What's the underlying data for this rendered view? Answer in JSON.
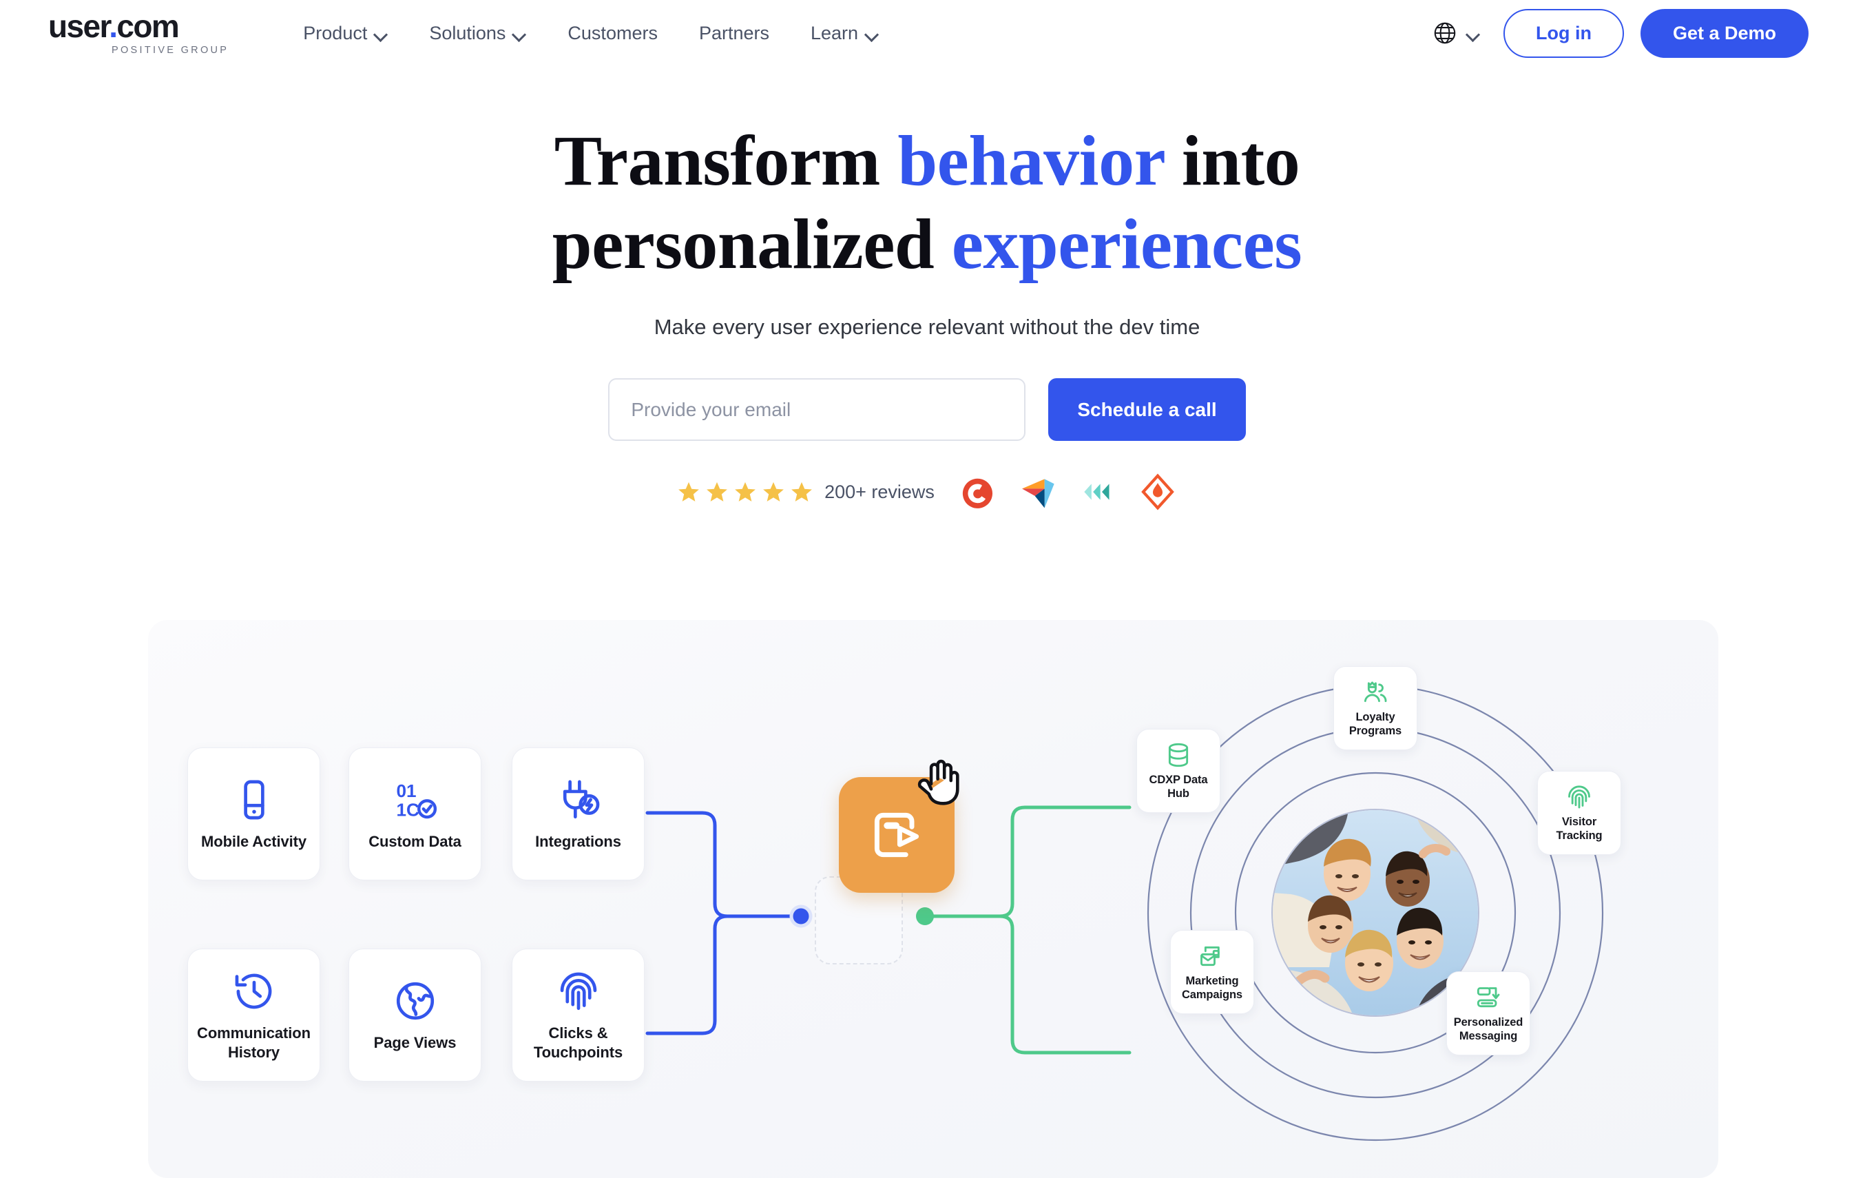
{
  "header": {
    "logo": {
      "text_main": "user",
      "text_dot": ".",
      "text_com": "com",
      "tagline": "POSITIVE GROUP"
    },
    "nav": [
      {
        "label": "Product",
        "has_dropdown": true
      },
      {
        "label": "Solutions",
        "has_dropdown": true
      },
      {
        "label": "Customers",
        "has_dropdown": false
      },
      {
        "label": "Partners",
        "has_dropdown": false
      },
      {
        "label": "Learn",
        "has_dropdown": true
      }
    ],
    "language_icon": "globe-icon",
    "login_label": "Log in",
    "demo_label": "Get a Demo"
  },
  "hero": {
    "headline_part1": "Transform ",
    "headline_highlight1": "behavior",
    "headline_part2": " into",
    "headline_part3": "personalized ",
    "headline_highlight2": "experiences",
    "subheadline": "Make every user experience relevant without the dev time",
    "email_placeholder": "Provide your email",
    "email_value": "",
    "cta_label": "Schedule a call",
    "reviews_count": "200+ reviews",
    "star_count": 5,
    "review_logos": [
      "g2-logo",
      "capterra-logo",
      "getapp-logo",
      "software-advice-logo"
    ]
  },
  "diagram": {
    "source_cards": [
      {
        "label": "Mobile Activity",
        "icon": "mobile-phone-icon"
      },
      {
        "label": "Custom Data",
        "icon": "binary-check-icon"
      },
      {
        "label": "Integrations",
        "icon": "plug-bolt-icon"
      },
      {
        "label": "Communication History",
        "icon": "clock-history-icon"
      },
      {
        "label": "Page Views",
        "icon": "globe-grid-icon"
      },
      {
        "label": "Clicks & Touchpoints",
        "icon": "fingerprint-icon"
      }
    ],
    "center_node": {
      "icon": "data-export-icon",
      "color": "#eda04a"
    },
    "cursor": "pointer-hand-cursor",
    "orbit_cards": [
      {
        "label": "Loyalty Programs",
        "icon": "loyalty-users-crown-icon"
      },
      {
        "label": "CDXP Data Hub",
        "icon": "database-icon"
      },
      {
        "label": "Visitor Tracking",
        "icon": "fingerprint-icon"
      },
      {
        "label": "Marketing Campaigns",
        "icon": "envelope-cards-icon"
      },
      {
        "label": "Personalized Messaging",
        "icon": "message-arrow-icon"
      }
    ],
    "center_photo": "group-of-people-photo",
    "orbit_ring_count": 3
  },
  "colors": {
    "brand_blue": "#3355ec",
    "nav_text": "#4a5266",
    "heading_dark": "#0d0d14",
    "orange_node": "#eda04a",
    "green_accent": "#4ec98a",
    "orbit_ring": "#7b86ad",
    "star_gold": "#f5c147"
  }
}
